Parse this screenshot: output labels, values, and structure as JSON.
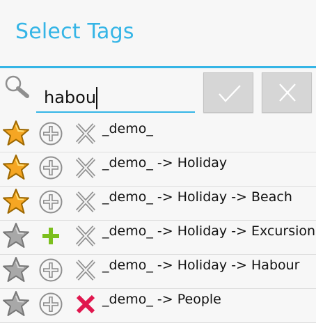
{
  "dialog": {
    "title": "Select Tags"
  },
  "search": {
    "value": "habou",
    "icon": "search-icon"
  },
  "actions": {
    "ok_icon": "check-icon",
    "cancel_icon": "close-icon"
  },
  "tags": [
    {
      "label": "_demo_",
      "favorite": true,
      "add_state": "outline",
      "remove_state": "outline"
    },
    {
      "label": "_demo_ -> Holiday",
      "favorite": true,
      "add_state": "outline",
      "remove_state": "outline"
    },
    {
      "label": "_demo_ -> Holiday -> Beach",
      "favorite": true,
      "add_state": "outline",
      "remove_state": "outline"
    },
    {
      "label": "_demo_ -> Holiday -> Excursion",
      "favorite": false,
      "add_state": "active",
      "remove_state": "outline"
    },
    {
      "label": "_demo_ -> Holiday -> Habour",
      "favorite": false,
      "add_state": "outline",
      "remove_state": "outline"
    },
    {
      "label": "_demo_ -> People",
      "favorite": false,
      "add_state": "outline",
      "remove_state": "active"
    }
  ],
  "colors": {
    "accent": "#35b5e6",
    "favorite_star": "#f5a623",
    "inactive_star": "#a8a8a8",
    "add_active": "#7cbf1e",
    "remove_active": "#e0174e"
  }
}
